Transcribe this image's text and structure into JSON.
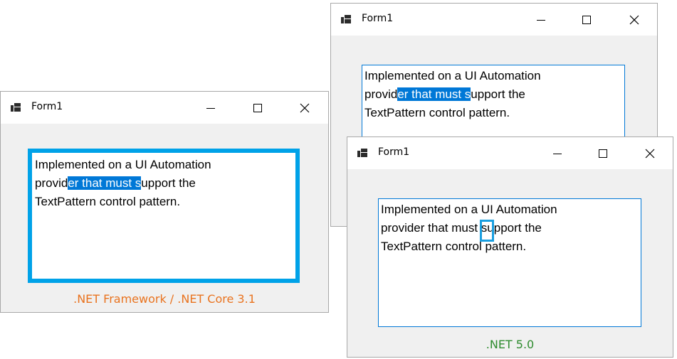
{
  "windows": {
    "left": {
      "title": "Form1",
      "text_lines": [
        {
          "pre": "Implemented on a UI Automation",
          "sel": "",
          "post": ""
        },
        {
          "pre": "provid",
          "sel": "er that must s",
          "post": "upport the"
        },
        {
          "pre": "TextPattern control pattern.",
          "sel": "",
          "post": ""
        }
      ],
      "caption": ".NET Framework / .NET Core 3.1",
      "caption_color": "#e9731f",
      "focus_border_color": "#00a2e8"
    },
    "top_right": {
      "title": "Form1",
      "text_lines": [
        {
          "pre": "Implemented on a UI Automation",
          "sel": "",
          "post": ""
        },
        {
          "pre": "provid",
          "sel": "er that must s",
          "post": "upport the"
        },
        {
          "pre": "TextPattern control pattern.",
          "sel": "",
          "post": ""
        }
      ]
    },
    "bottom_right": {
      "title": "Form1",
      "text_lines": [
        {
          "pre": "Implemented on a UI Automation",
          "sel": "",
          "post": ""
        },
        {
          "pre": "provider that m",
          "sel": "u",
          "post": "st support the"
        },
        {
          "pre": "TextPattern control pattern.",
          "sel": "",
          "post": ""
        }
      ],
      "caption": ".NET 5.0",
      "caption_color": "#2e8b2e"
    }
  },
  "icons": {
    "app": "form-app-icon",
    "minimize": "minimize-icon",
    "maximize": "maximize-icon",
    "close": "close-icon"
  },
  "colors": {
    "selection_bg": "#0078d7",
    "textbox_border": "#0078d7",
    "window_bg": "#f0f0f0"
  }
}
